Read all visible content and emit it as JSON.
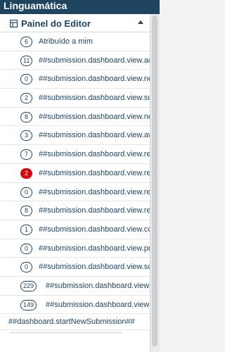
{
  "app": {
    "title": "Linguamática"
  },
  "panel": {
    "title": "Painel do Editor"
  },
  "rows": [
    {
      "count": "6",
      "label": "Atribuído a mim",
      "alert": false
    },
    {
      "count": "11",
      "label": "##submission.dashboard.view.active",
      "alert": false
    },
    {
      "count": "0",
      "label": "##submission.dashboard.view.needsEditor",
      "alert": false
    },
    {
      "count": "2",
      "label": "##submission.dashboard.view.submission",
      "alert": false
    },
    {
      "count": "8",
      "label": "##submission.dashboard.view.needsReviewers",
      "alert": false
    },
    {
      "count": "3",
      "label": "##submission.dashboard.view.awaitingReviewers",
      "alert": false
    },
    {
      "count": "7",
      "label": "##submission.dashboard.view.reviewsSubmitted",
      "alert": false
    },
    {
      "count": "2",
      "label": "##submission.dashboard.view.reviewsOverdue",
      "alert": true
    },
    {
      "count": "0",
      "label": "##submission.dashboard.view.revisionsRequested",
      "alert": false
    },
    {
      "count": "8",
      "label": "##submission.dashboard.view.reviewsCompleted",
      "alert": false
    },
    {
      "count": "1",
      "label": "##submission.dashboard.view.copyediting",
      "alert": false
    },
    {
      "count": "0",
      "label": "##submission.dashboard.view.production",
      "alert": false
    },
    {
      "count": "0",
      "label": "##submission.dashboard.view.scheduled",
      "alert": false
    },
    {
      "count": "229",
      "label": "##submission.dashboard.view.published",
      "alert": false
    },
    {
      "count": "149",
      "label": "##submission.dashboard.view.declined",
      "alert": false
    }
  ],
  "start_submission": {
    "label": "##dashboard.startNewSubmission##"
  },
  "colors": {
    "header_bg": "#1e4460",
    "alert": "#d00a0a"
  }
}
